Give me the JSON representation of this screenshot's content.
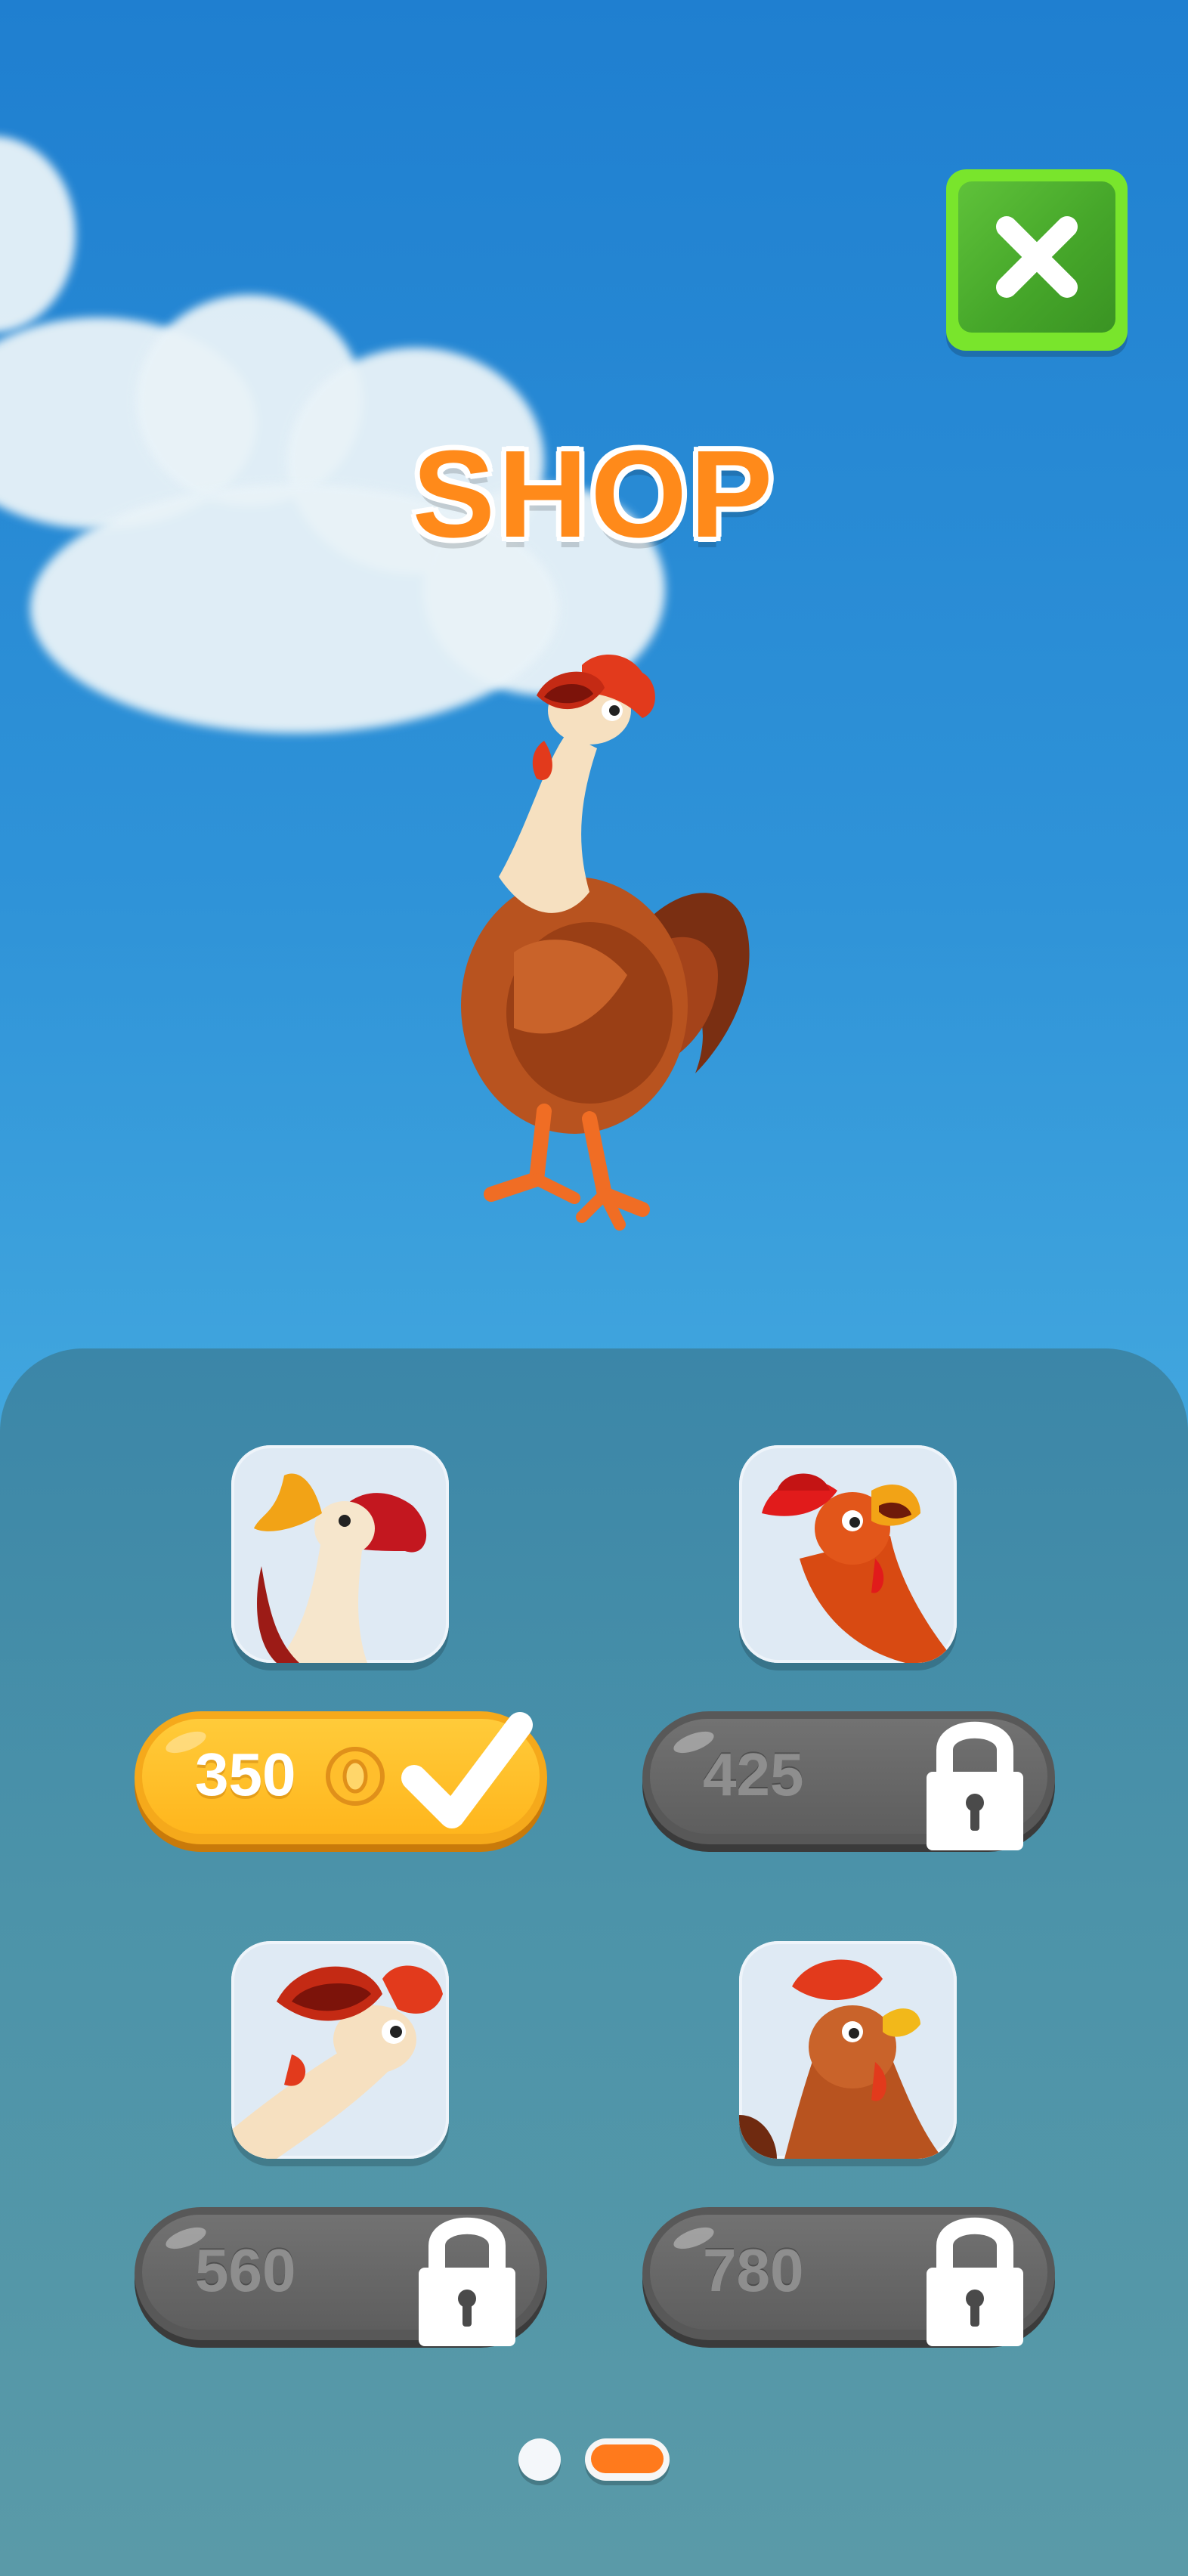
{
  "header": {
    "title": "SHOP",
    "close_icon": "close-icon"
  },
  "colors": {
    "accent": "#ff8a1a",
    "close_button": "#79e52c",
    "owned_pill": "#ffb61d",
    "locked_pill": "#5e5e5e"
  },
  "items": [
    {
      "price": "350",
      "state": "owned",
      "icons": [
        "coin-icon",
        "checkmark-icon"
      ]
    },
    {
      "price": "425",
      "state": "locked",
      "icons": [
        "lock-icon"
      ]
    },
    {
      "price": "560",
      "state": "locked",
      "icons": [
        "lock-icon"
      ]
    },
    {
      "price": "780",
      "state": "locked",
      "icons": [
        "lock-icon"
      ]
    }
  ],
  "pagination": {
    "current_page": 2,
    "total_pages": 2
  }
}
